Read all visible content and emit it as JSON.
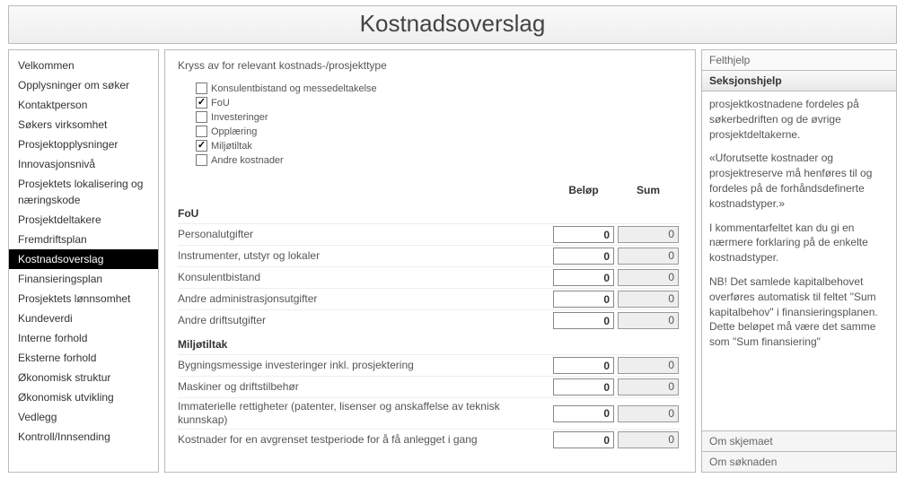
{
  "title": "Kostnadsoverslag",
  "sidebar": {
    "items": [
      "Velkommen",
      "Opplysninger om søker",
      "Kontaktperson",
      "Søkers virksomhet",
      "Prosjektopplysninger",
      "Innovasjonsnivå",
      "Prosjektets lokalisering og næringskode",
      "Prosjektdeltakere",
      "Fremdriftsplan",
      "Kostnadsoverslag",
      "Finansieringsplan",
      "Prosjektets lønnsomhet",
      "Kundeverdi",
      "Interne forhold",
      "Eksterne forhold",
      "Økonomisk struktur",
      "Økonomisk utvikling",
      "Vedlegg",
      "Kontroll/Innsending"
    ],
    "selectedIndex": 9
  },
  "main": {
    "instruction": "Kryss av for relevant kostnads-/prosjekttype",
    "types": [
      {
        "label": "Konsulentbistand og messedeltakelse",
        "checked": false
      },
      {
        "label": "FoU",
        "checked": true
      },
      {
        "label": "Investeringer",
        "checked": false
      },
      {
        "label": "Opplæring",
        "checked": false
      },
      {
        "label": "Miljøtiltak",
        "checked": true
      },
      {
        "label": "Andre kostnader",
        "checked": false
      }
    ],
    "headers": {
      "amount": "Beløp",
      "sum": "Sum"
    },
    "groups": [
      {
        "title": "FoU",
        "rows": [
          {
            "label": "Personalutgifter",
            "amount": 0,
            "sum": 0
          },
          {
            "label": "Instrumenter, utstyr og lokaler",
            "amount": 0,
            "sum": 0
          },
          {
            "label": "Konsulentbistand",
            "amount": 0,
            "sum": 0
          },
          {
            "label": "Andre administrasjonsutgifter",
            "amount": 0,
            "sum": 0
          },
          {
            "label": "Andre driftsutgifter",
            "amount": 0,
            "sum": 0
          }
        ]
      },
      {
        "title": "Miljøtiltak",
        "rows": [
          {
            "label": "Bygningsmessige investeringer inkl. prosjektering",
            "amount": 0,
            "sum": 0
          },
          {
            "label": "Maskiner og driftstilbehør",
            "amount": 0,
            "sum": 0
          },
          {
            "label": "Immaterielle rettigheter (patenter, lisenser og anskaffelse av teknisk kunnskap)",
            "amount": 0,
            "sum": 0
          },
          {
            "label": "Kostnader for en avgrenset testperiode for å få anlegget i gang",
            "amount": 0,
            "sum": 0
          }
        ]
      }
    ]
  },
  "help": {
    "fieldHelp": "Felthjelp",
    "sectionHelp": "Seksjonshjelp",
    "paragraphs": [
      "prosjektkostnadene fordeles på søkerbedriften og de øvrige prosjektdeltakerne.",
      "«Uforutsette kostnader og prosjektreserve må henføres til og fordeles på de forhåndsdefinerte kostnadstyper.»",
      "I kommentarfeltet kan du gi en nærmere forklaring på de enkelte kostnadstyper.",
      "NB!  Det samlede kapitalbehovet overføres automatisk til feltet \"Sum kapitalbehov\" i finansieringsplanen.  Dette beløpet må være det samme som \"Sum finansiering\""
    ],
    "aboutForm": "Om skjemaet",
    "aboutApplication": "Om søknaden"
  }
}
